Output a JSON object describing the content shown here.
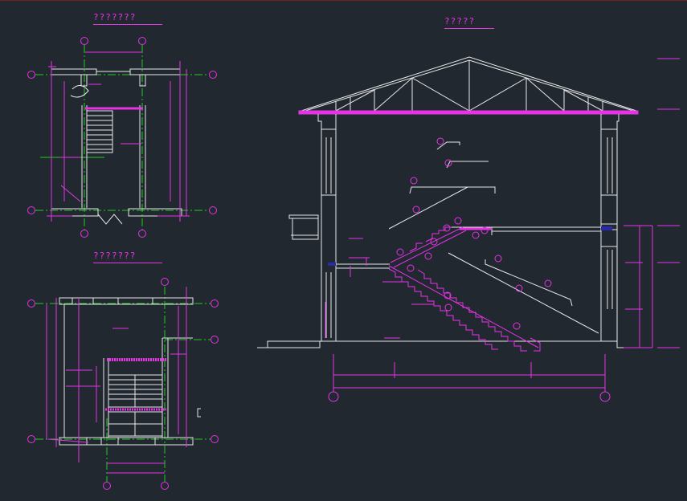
{
  "drawing": {
    "titles": {
      "upper_left": "???????",
      "lower_left": "???????",
      "section": "?????"
    }
  },
  "colors": {
    "background": "#212830",
    "wall": "#e8e8e8",
    "dimension": "#e633e6",
    "axis": "#22cc22",
    "accent": "#2a2aa8",
    "border": "#7a1f1f"
  }
}
